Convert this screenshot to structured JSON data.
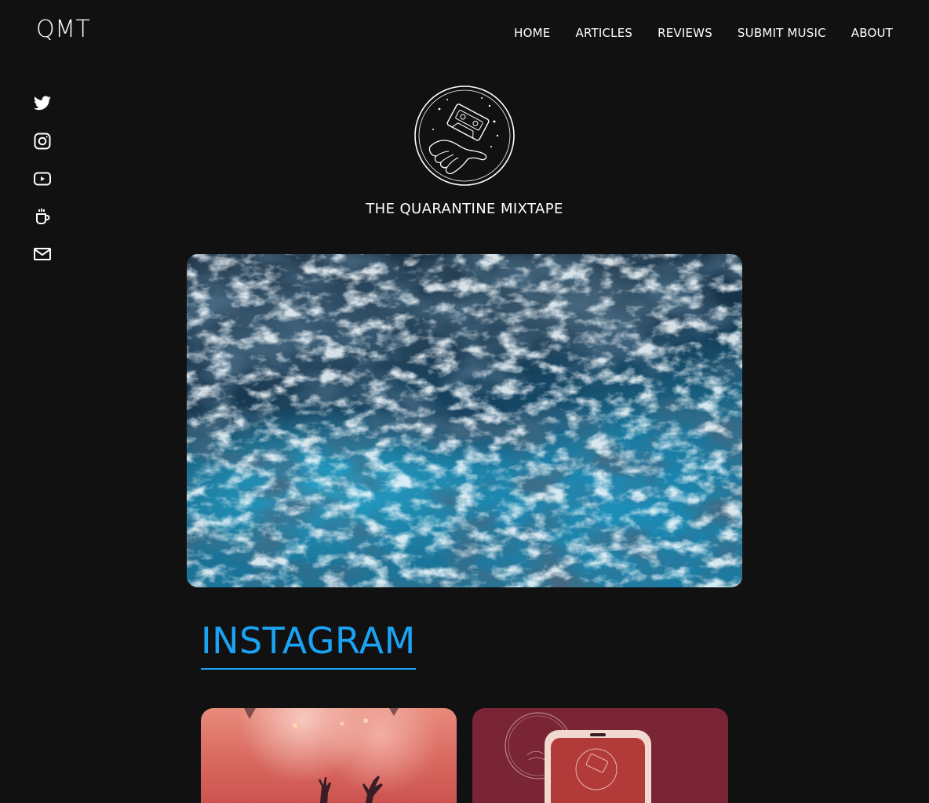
{
  "header": {
    "brand": "QMT",
    "nav": [
      "HOME",
      "ARTICLES",
      "REVIEWS",
      "SUBMIT MUSIC",
      "ABOUT"
    ]
  },
  "social": {
    "icons": [
      "twitter-icon",
      "instagram-icon",
      "youtube-icon",
      "coffee-cup-icon",
      "mail-icon"
    ]
  },
  "site": {
    "title": "THE QUARANTINE MIXTAPE"
  },
  "instagram": {
    "heading": "INSTAGRAM"
  },
  "colors": {
    "background": "#111111",
    "accent": "#1aa3f2",
    "text": "#ffffff"
  }
}
